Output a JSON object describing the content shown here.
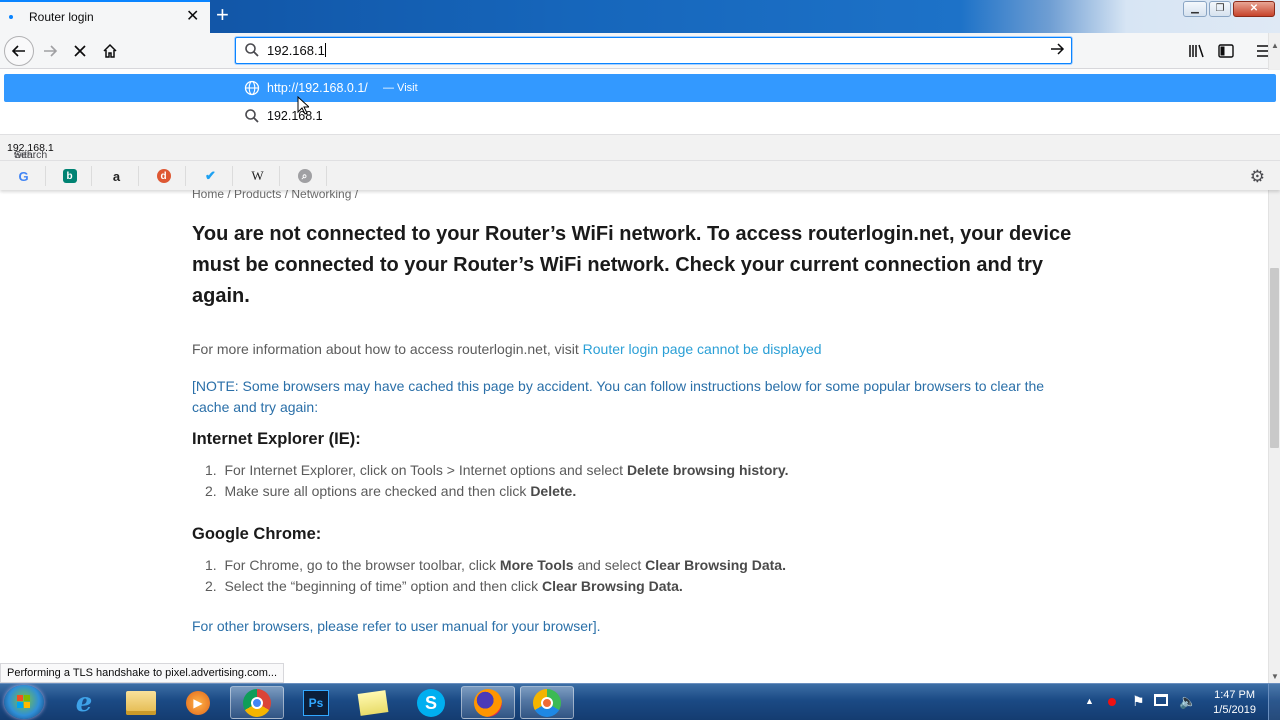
{
  "browser": {
    "tab": {
      "title": "Router login"
    },
    "newtab_label": "+",
    "url": {
      "value": "192.168.1"
    },
    "dropdown": {
      "suggestion_url": "http://192.168.0.1/",
      "suggestion_action": "— Visit",
      "search_suggestion": "192.168.1",
      "search_for_prefix": "Search for ",
      "search_for_term": "192.168.1",
      "search_for_suffix": " with:",
      "engines": [
        "google",
        "bing",
        "amazon",
        "duckduckgo",
        "twitter",
        "wikipedia",
        "search"
      ]
    },
    "status": "Performing a TLS handshake to pixel.advertising.com..."
  },
  "page": {
    "breadcrumb": "Home / Products / Networking /",
    "headline": "You are not connected to your Router’s WiFi network. To access routerlogin.net, your device must be connected to your Router’s WiFi network. Check your current connection and try again.",
    "info_text": "For more information about how to access routerlogin.net, visit ",
    "info_link": "Router login page cannot be displayed",
    "note": "[NOTE: Some browsers may have cached this page by accident. You can follow instructions below for some popular browsers to clear the cache and try again:",
    "ie": {
      "heading": "Internet Explorer (IE):",
      "step1_text": "For Internet Explorer, click on Tools > Internet options and select ",
      "step1_bold": "Delete browsing history.",
      "step2_text": "Make sure all options are checked and then click ",
      "step2_bold": "Delete."
    },
    "chrome": {
      "heading": "Google Chrome:",
      "step1_text": "For Chrome, go to the browser toolbar, click ",
      "step1_bold_a": "More Tools",
      "step1_mid": " and select ",
      "step1_bold_b": "Clear Browsing Data.",
      "step2_text": "Select the “beginning of time” option and then click ",
      "step2_bold": "Clear Browsing Data."
    },
    "other": "For other browsers, please refer to user manual for your browser]."
  },
  "taskbar": {
    "apps": [
      "start",
      "internet-explorer",
      "file-explorer",
      "media-player",
      "chrome",
      "photoshop",
      "sticky-notes",
      "skype",
      "firefox",
      "chrome-canary"
    ],
    "clock_time": "1:47 PM",
    "clock_date": "1/5/2019"
  },
  "colors": {
    "accent": "#0a84ff",
    "selection": "#3399ff",
    "link": "#2a9fd6"
  }
}
